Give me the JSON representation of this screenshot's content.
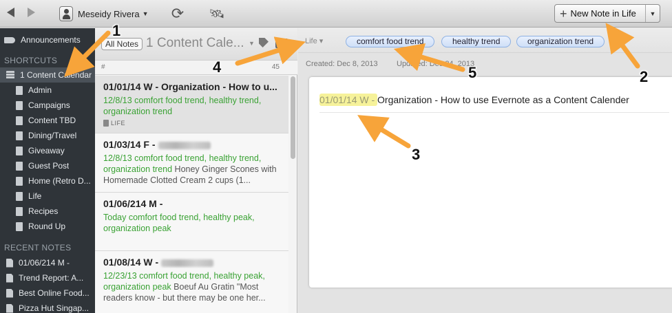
{
  "toolbar": {
    "account_name": "Meseidy Rivera",
    "new_note_label": "New Note in Life"
  },
  "sidebar": {
    "announcements": "Announcements",
    "shortcuts_heading": "SHORTCUTS",
    "stack": "1 Content Calendar",
    "notebooks": [
      "Admin",
      "Campaigns",
      "Content TBD",
      "Dining/Travel",
      "Giveaway",
      "Guest Post",
      "Home (Retro D...",
      "Life",
      "Recipes",
      "Round Up"
    ],
    "recent_heading": "RECENT NOTES",
    "recent": [
      "01/06/214 M -",
      "Trend Report: A...",
      "Best Online Food...",
      "Pizza Hut Singap..."
    ]
  },
  "notelist": {
    "all_notes": "All Notes",
    "notebook_title": "1 Content Cale...",
    "sort_hash": "#",
    "count": "45",
    "notes": [
      {
        "title": "01/01/14 W - Organization - How to u...",
        "green": "12/8/13  comfort food trend, healthy trend, organization trend",
        "rest": "",
        "notebook": "LIFE"
      },
      {
        "title": "01/03/14  F -",
        "green": "12/8/13  comfort food trend, healthy trend, organization trend",
        "rest": "  Honey Ginger Scones with Homemade Clotted Cream 2 cups (1...",
        "notebook": ""
      },
      {
        "title": "01/06/214 M -",
        "green": "Today  comfort food trend, healthy peak, organization peak",
        "rest": "",
        "notebook": ""
      },
      {
        "title": "01/08/14 W -",
        "green": "12/23/13  comfort food trend, healthy peak, organization peak",
        "rest": "  Boeuf Au Gratin \"Most readers know - but there may be one her...",
        "notebook": ""
      }
    ]
  },
  "editor": {
    "notebook": "Life",
    "tags": [
      "comfort food trend",
      "healthy trend",
      "organization trend"
    ],
    "created": "Created: Dec 8, 2013",
    "updated": "Updated: Dec 24, 2013",
    "title_prefix": "01/01/14 W - ",
    "title_rest": "Organization - How to use Evernote as a Content Calender"
  },
  "annotations": {
    "markers": [
      "1",
      "2",
      "3",
      "4",
      "5"
    ],
    "arrow_color": "#f7a43a"
  }
}
